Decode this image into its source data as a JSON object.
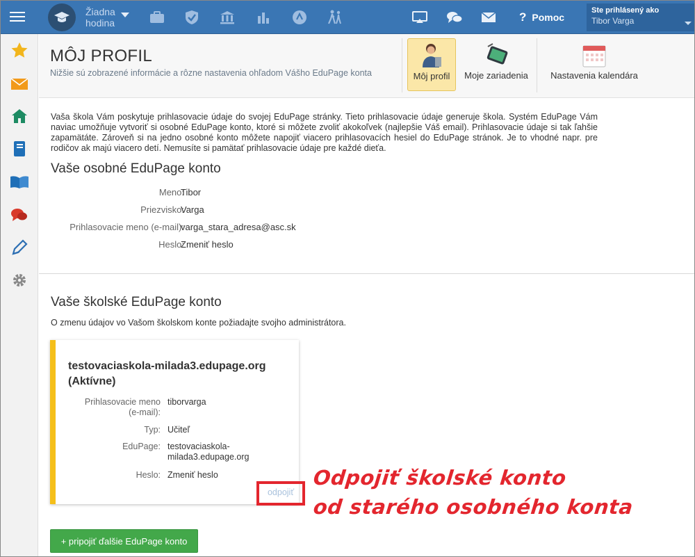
{
  "topbar": {
    "lesson_line1": "Žiadna",
    "lesson_line2": "hodina",
    "help_label": "Pomoc",
    "user_caption": "Ste prihlásený ako",
    "user_name": "Tibor Varga",
    "icons": [
      "menu-icon",
      "graduation-cap-icon",
      "briefcase-icon",
      "shield-check-icon",
      "bank-icon",
      "bar-chart-icon",
      "badge-icon",
      "walking-people-icon",
      "cast-icon",
      "chat-bubbles-icon",
      "mail-icon",
      "help-icon"
    ],
    "bg_color": "#3a76b4"
  },
  "sidebar": {
    "items": [
      "star-icon",
      "envelope-icon",
      "home-icon",
      "notebook-icon",
      "open-book-icon",
      "chat-icon",
      "pencil-icon",
      "gear-icon"
    ]
  },
  "header": {
    "title": "MÔJ PROFIL",
    "subtitle": "Nižšie sú zobrazené informácie a rôzne nastavenia ohľadom Vášho EduPage konta",
    "tabs": [
      {
        "label": "Môj profil",
        "active": true
      },
      {
        "label": "Moje zariadenia",
        "active": false
      },
      {
        "label": "Nastavenia kalendára",
        "active": false
      }
    ]
  },
  "intro": "Vaša škola Vám poskytuje prihlasovacie údaje do svojej EduPage stránky. Tieto prihlasovacie údaje generuje škola. Systém EduPage Vám naviac umožňuje vytvoriť si osobné EduPage konto, ktoré si môžete zvoliť akokoľvek (najlepšie Váš email). Prihlasovacie údaje si tak ľahšie zapamätáte. Zároveň si na jedno osobné konto môžete napojiť viacero prihlasovacích hesiel do EduPage stránok. Je to vhodné napr. pre rodičov ak majú viacero detí. Nemusíte si pamätať prihlasovacie údaje pre každé dieťa.",
  "personal": {
    "heading": "Vaše osobné EduPage konto",
    "fields": [
      {
        "label": "Meno:",
        "value": "Tibor"
      },
      {
        "label": "Priezvisko:",
        "value": "Varga"
      },
      {
        "label": "Prihlasovacie meno (e-mail):",
        "value": "varga_stara_adresa@asc.sk"
      },
      {
        "label": "Heslo:",
        "value": "Zmeniť heslo"
      }
    ]
  },
  "school": {
    "heading": "Vaše školské EduPage konto",
    "note": "O zmenu údajov vo Vašom školskom konte požiadajte svojho administrátora.",
    "card": {
      "title_line1": "testovaciaskola-milada3.edupage.org",
      "title_line2": "(Aktívne)",
      "login_label_line1": "Prihlasovacie meno",
      "login_label_line2": "(e-mail):",
      "login_value": "tiborvarga",
      "type_label": "Typ:",
      "type_value": "Učiteľ",
      "edupage_label": "EduPage:",
      "edupage_value_line1": "testovaciaskola-",
      "edupage_value_line2": "milada3.edupage.org",
      "password_label": "Heslo:",
      "password_link": "Zmeniť heslo",
      "disconnect_label": "odpojiť",
      "accent_color": "#f5bf1a"
    },
    "add_button": "+ pripojiť ďalšie EduPage konto"
  },
  "annotation": {
    "line1": "Odpojiť školské konto",
    "line2": "od starého osobného konta",
    "color": "#e3262e"
  }
}
